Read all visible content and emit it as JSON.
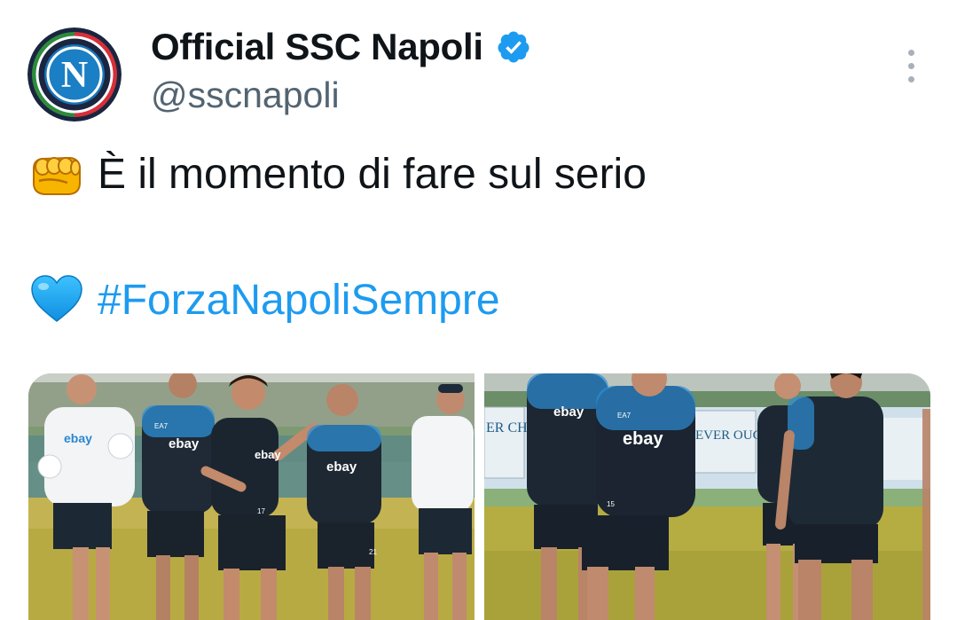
{
  "tweet": {
    "display_name": "Official SSC Napoli",
    "handle": "@sscnapoli",
    "verified": true,
    "avatar_letter": "N",
    "avatar_icon": "ssc-napoli-crest",
    "line1_emoji": "oncoming-fist-emoji",
    "line1_text": "È il momento di fare sul serio",
    "line2_emoji": "blue-heart-emoji",
    "hashtag": "#ForzaNapoliSempre"
  },
  "media": {
    "left": {
      "logo_text": "ebay",
      "kit_text": "EA7",
      "player_numbers": [
        "17",
        "21"
      ]
    },
    "right": {
      "logo_text": "ebay",
      "kit_text": "EA7",
      "banner_text": "EVER OUCH",
      "banner_left_text": "ER CH",
      "player_numbers": [
        "15"
      ]
    }
  },
  "colors": {
    "text_primary": "#0f1419",
    "text_secondary": "#536471",
    "link": "#1d9bf0",
    "verified": "#1d9bf0"
  }
}
